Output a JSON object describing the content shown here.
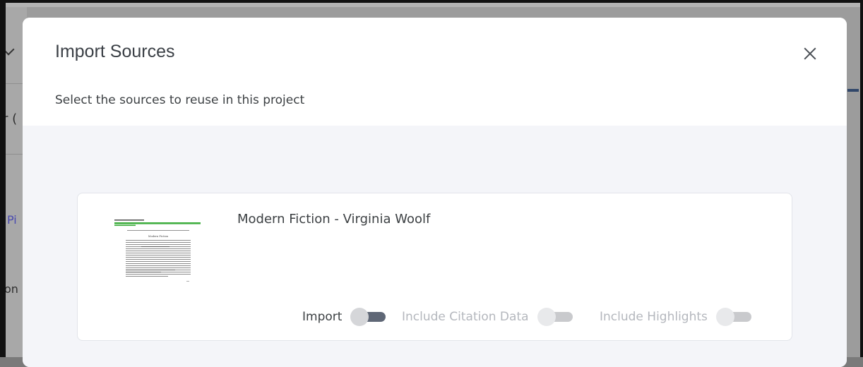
{
  "modal": {
    "title": "Import Sources",
    "subtitle": "Select the sources to reuse in this project"
  },
  "background": {
    "text_fragments": [
      "r (",
      "Pi",
      "on"
    ]
  },
  "source": {
    "title": "Modern Fiction - Virginia Woolf",
    "thumbnail_heading": "Modern Fiction",
    "toggles": [
      {
        "label": "Import",
        "enabled": false
      },
      {
        "label": "Include Citation Data",
        "enabled": false
      },
      {
        "label": "Include Highlights",
        "enabled": false
      }
    ]
  },
  "colors": {
    "overlay": "#9c9c9c",
    "modal_body": "#f4f5f9",
    "accent_dark": "#31476a",
    "highlight_green": "#3fae3f"
  }
}
